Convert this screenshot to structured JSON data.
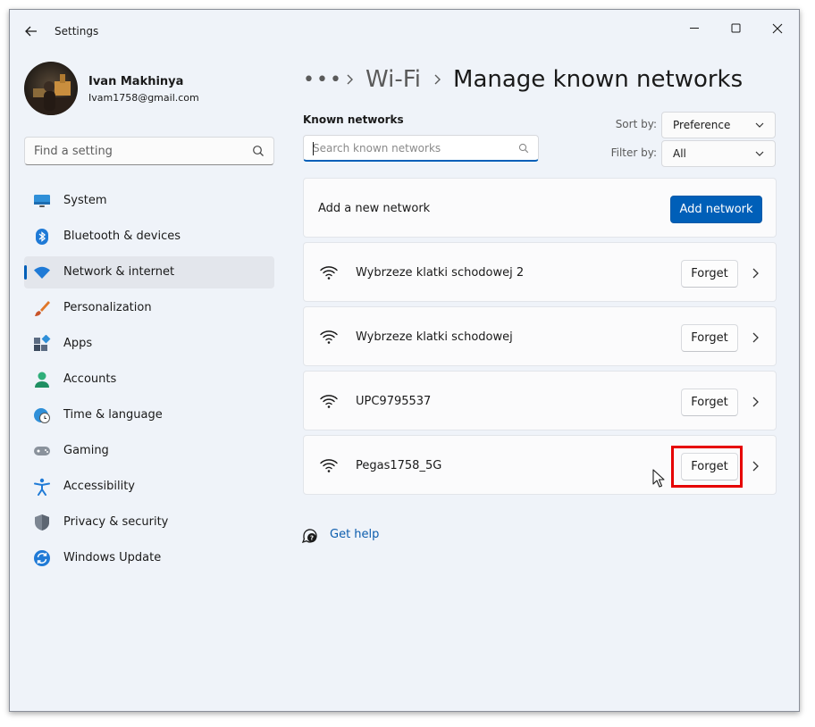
{
  "window": {
    "app_title": "Settings"
  },
  "profile": {
    "name": "Ivan Makhinya",
    "email": "Ivam1758@gmail.com"
  },
  "sidebar": {
    "search_placeholder": "Find a setting",
    "items": [
      {
        "label": "System",
        "icon": "monitor-icon",
        "active": false
      },
      {
        "label": "Bluetooth & devices",
        "icon": "bluetooth-icon",
        "active": false
      },
      {
        "label": "Network & internet",
        "icon": "wifi-icon",
        "active": true
      },
      {
        "label": "Personalization",
        "icon": "brush-icon",
        "active": false
      },
      {
        "label": "Apps",
        "icon": "apps-icon",
        "active": false
      },
      {
        "label": "Accounts",
        "icon": "person-icon",
        "active": false
      },
      {
        "label": "Time & language",
        "icon": "clock-globe-icon",
        "active": false
      },
      {
        "label": "Gaming",
        "icon": "gamepad-icon",
        "active": false
      },
      {
        "label": "Accessibility",
        "icon": "accessibility-icon",
        "active": false
      },
      {
        "label": "Privacy & security",
        "icon": "shield-icon",
        "active": false
      },
      {
        "label": "Windows Update",
        "icon": "update-icon",
        "active": false
      }
    ]
  },
  "breadcrumb": {
    "more": "•••",
    "parent": "Wi-Fi",
    "current": "Manage known networks"
  },
  "known_networks": {
    "label": "Known networks",
    "search_placeholder": "Search known networks",
    "sort_label": "Sort by:",
    "sort_value": "Preference",
    "filter_label": "Filter by:",
    "filter_value": "All",
    "add_text": "Add a new network",
    "add_button": "Add network",
    "forget_label": "Forget",
    "networks": [
      {
        "name": "Wybrzeze klatki schodowej 2"
      },
      {
        "name": "Wybrzeze klatki schodowej"
      },
      {
        "name": "UPC9795537"
      },
      {
        "name": "Pegas1758_5G"
      }
    ]
  },
  "help": {
    "label": "Get help"
  },
  "colors": {
    "accent": "#005fb8",
    "highlight": "#e60000",
    "background": "#eff3f9"
  }
}
